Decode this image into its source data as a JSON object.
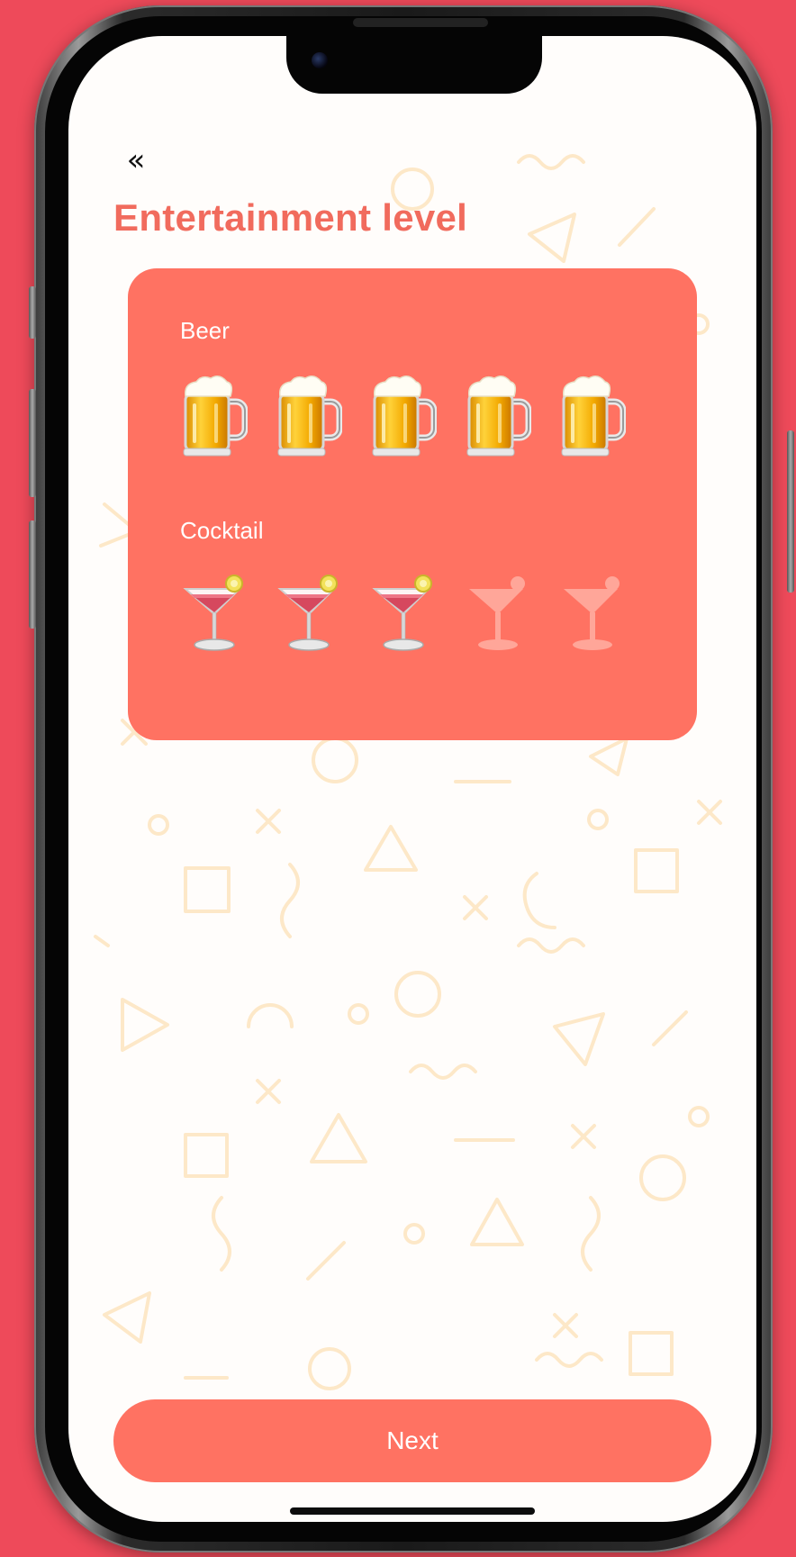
{
  "header": {
    "back_glyph": "«",
    "title": "Entertainment level"
  },
  "card": {
    "beer": {
      "label": "Beer",
      "icon": "beer-mug-icon",
      "rating": 5,
      "max": 5
    },
    "cocktail": {
      "label": "Cocktail",
      "icon": "cocktail-glass-icon",
      "rating": 3,
      "max": 5
    }
  },
  "footer": {
    "next_label": "Next"
  },
  "colors": {
    "background": "#ee4a5a",
    "accent": "#ff7262",
    "title": "#f16b5d",
    "pattern": "#fde8c8"
  }
}
